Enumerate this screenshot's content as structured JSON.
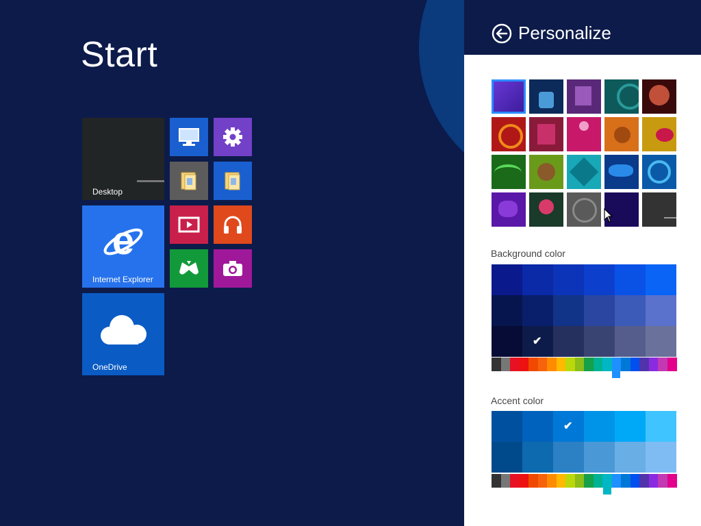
{
  "start": {
    "title": "Start",
    "tiles": {
      "desktop": "Desktop",
      "ie": "Internet Explorer",
      "onedrive": "OneDrive"
    }
  },
  "panel": {
    "title": "Personalize",
    "background_label": "Background color",
    "accent_label": "Accent color"
  },
  "icons": {
    "back": "back-arrow-icon",
    "ie": "internet-explorer-icon",
    "onedrive": "cloud-icon",
    "settings": "gear-icon",
    "explorer": "folder-icon",
    "music": "headphones-icon",
    "video": "video-icon",
    "games": "xbox-controller-icon",
    "camera": "camera-icon",
    "pc": "computer-icon"
  },
  "colors": {
    "start_bg": "#0d1b4a",
    "accent_selected": "#0078d7",
    "panel_bg": "#ffffff"
  },
  "background_grid": [
    [
      "#0a1a8c",
      "#0a2aa8",
      "#0c34b8",
      "#0c40cc",
      "#0a52e6",
      "#0a64f6"
    ],
    [
      "#06154d",
      "#0a1f6b",
      "#123488",
      "#2b46a0",
      "#3c5ab8",
      "#5a72cc"
    ],
    [
      "#060c35",
      "#0d1b4a",
      "#26305f",
      "#3a4472",
      "#555d8c",
      "#6a719a"
    ]
  ],
  "background_selected": [
    2,
    1
  ],
  "accent_grid": [
    [
      "#0050a0",
      "#0062bc",
      "#0078d7",
      "#0094e8",
      "#00a8f8",
      "#40c4ff"
    ],
    [
      "#004a8c",
      "#0e6aae",
      "#2c80c4",
      "#4a98d6",
      "#6aaee6",
      "#80bcf4"
    ]
  ],
  "accent_selected": [
    0,
    2
  ],
  "hue_strip": [
    "#333333",
    "#777777",
    "#e81123",
    "#ee1111",
    "#f04a00",
    "#f7630c",
    "#ff8c00",
    "#ffb900",
    "#bad80a",
    "#8cbd18",
    "#16a04a",
    "#00b294",
    "#00b7c3",
    "#1e90ff",
    "#0078d7",
    "#0050ef",
    "#5133ab",
    "#8a2be2",
    "#c239b3",
    "#e3008c"
  ],
  "background_hue_index": 13,
  "accent_hue_index": 12
}
